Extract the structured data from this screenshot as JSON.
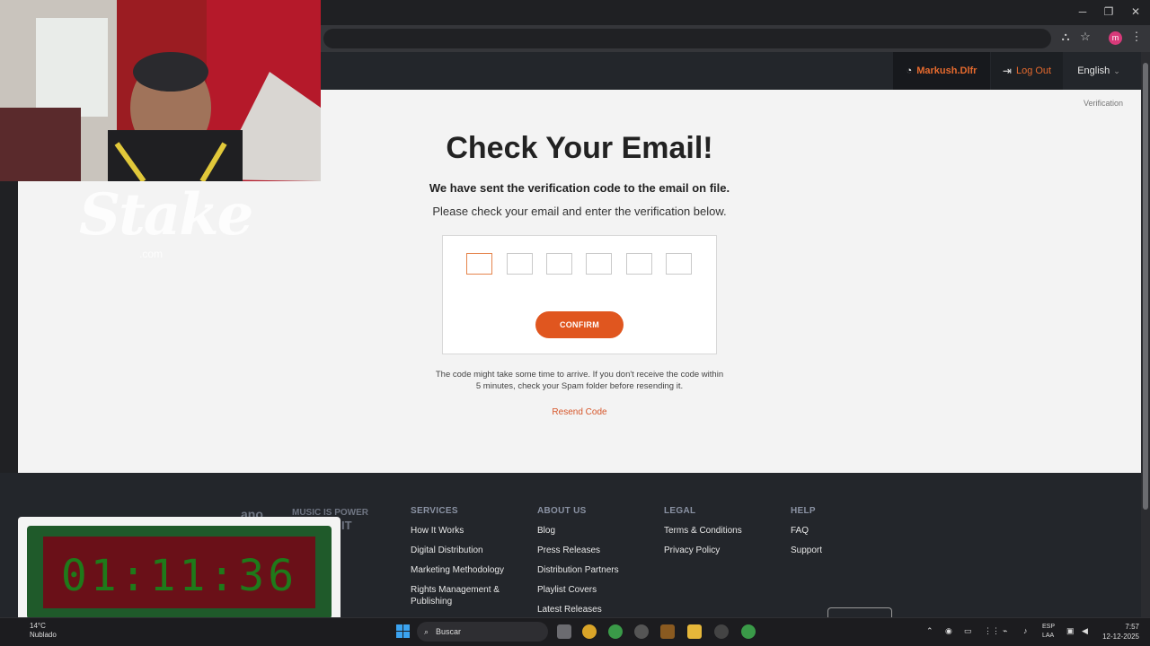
{
  "browser": {
    "minimize_glyph": "─",
    "restore_glyph": "❐",
    "close_glyph": "✕",
    "profile_initial": "m"
  },
  "header": {
    "username": "Markush.Dlfr",
    "logout_label": "Log Out",
    "language": "English"
  },
  "main": {
    "breadcrumb": "Verification",
    "title": "Check Your Email!",
    "subtitle": "We have sent the verification code to the email on file.",
    "instruction": "Please check your email and enter the verification below.",
    "confirm_label": "CONFIRM",
    "note_line1": "The code might take some time to arrive. If you don't receive the code within",
    "note_line2": "5 minutes, check your Spam folder before resending it.",
    "resend_label": "Resend Code",
    "watermark_logo": "Stake",
    "watermark_sub": ".com"
  },
  "footer": {
    "brand_partial": "ano",
    "tagline_1": "MUSIC IS POWER",
    "tagline_2": "TY IT",
    "columns": [
      {
        "heading": "SERVICES",
        "items": [
          "How It Works",
          "Digital Distribution",
          "Marketing Methodology",
          "Rights Management & Publishing"
        ]
      },
      {
        "heading": "ABOUT US",
        "items": [
          "Blog",
          "Press Releases",
          "Distribution Partners",
          "Playlist Covers",
          "Latest Releases"
        ]
      },
      {
        "heading": "LEGAL",
        "items": [
          "Terms & Conditions",
          "Privacy Policy"
        ]
      },
      {
        "heading": "HELP",
        "items": [
          "FAQ",
          "Support"
        ]
      }
    ]
  },
  "timer": {
    "value": "01:11:36"
  },
  "taskbar": {
    "weather_temp": "14°C",
    "weather_desc": "Nublado",
    "search_placeholder": "Buscar",
    "lang_top": "ESP",
    "lang_bottom": "LAA",
    "time": "7:57",
    "date": "12-12-2025"
  }
}
